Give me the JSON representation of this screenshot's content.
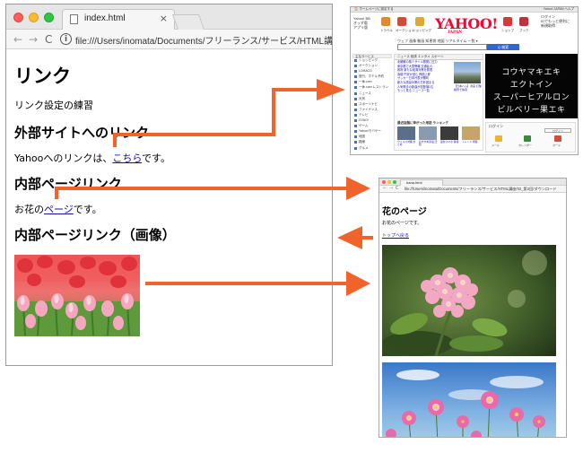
{
  "main_window": {
    "tab_title": "index.html",
    "tab_close": "×",
    "url": "file:///Users/inomata/Documents/フリーランス/サービス/HTML講座/02_第2回/サ",
    "nav_back": "←",
    "nav_forward": "→",
    "nav_reload": "C",
    "info": "i",
    "page": {
      "h1": "リンク",
      "intro": "リンク設定の練習",
      "h2_external": "外部サイトへのリンク",
      "external_text_before": "Yahooへのリンクは、",
      "external_link": "こちら",
      "external_text_after": "です。",
      "h2_internal": "内部ページリンク",
      "internal_text_before": "お花の",
      "internal_link": "ページ",
      "internal_text_after": "です。",
      "h2_internal_image": "内部ページリンク（画像）"
    }
  },
  "yahoo_window": {
    "topbar_left": "🏠 ホームページに設定する",
    "topbar_right": "Yahoo! JAPAN ヘルプ",
    "left_small": [
      "Yahoo! BB",
      "きっず版",
      "アプリ版"
    ],
    "services": [
      "トラベル",
      "オークション",
      "ショッピング",
      "ショップ",
      "ブック"
    ],
    "logo": "YAHOO!",
    "logo_sub": "JAPAN",
    "right_small": [
      "ログイン",
      "IDでもっと便利に",
      "新規取得"
    ],
    "search_tabs": "ウェブ  画像  動画  知恵袋  地図  リアルタイム  一覧 ▾",
    "search_button": "Q 検索",
    "sidebar_head": "主なサービス",
    "sidebar_items": [
      "ショッピング",
      "オークション",
      "LOHACO",
      "旅行、ホテル予約",
      "一休.com",
      "一休.com レストラン",
      "ニュース",
      "天気",
      "スポーツナビ",
      "ファイナンス",
      "テレビ",
      "GYAO!",
      "ゲーム",
      "Yahoo!モバゲー",
      "地図",
      "路線",
      "グルメ"
    ],
    "news_tabs": "ニュース  経済  エンタメ  スポーツ",
    "news_lines": [
      "北朝鮮の核ミサイル開発に圧力",
      "東京都で大雪警報 交通乱れ",
      "政府 新たな経済対策を発表",
      "為替 円安が進む 株価上昇",
      "サッカー日本代表が勝利",
      "新たな感染対策の方針固まる",
      "人気歌手の新曲が初登場1位",
      "もっと見る ニュース一覧"
    ],
    "news_photo_caption": "【日本ハム】清宮 打撃練習で快音",
    "news2_title": "最近話題に挙がった用語 ランキング",
    "thumb_captions": [
      "ウイルス対策 まとめ",
      "おすすめ家電 比較",
      "最新スマホ 情報",
      "トレンド 特集"
    ],
    "ad_lines": [
      "コウヤマキエキ",
      "エクトイン",
      "スーパーヒアルロン",
      "ビルベリー果エキ"
    ],
    "login_title": "ログイン",
    "login_button": "ログイン",
    "login_icons": [
      "メール",
      "カレンダー",
      "カード"
    ]
  },
  "hana_window": {
    "tab_title": "hana.html",
    "url": "file:///Users/inomata/Documents/フリーランス/サービス/HTML講座/02_第2回/ダウンロード",
    "h1": "花のページ",
    "text": "お花のページです。",
    "link": "トップへ戻る"
  },
  "colors": {
    "arrow": "#f0632a",
    "link": "#1a0dab",
    "yahoo_red": "#ff0033"
  }
}
